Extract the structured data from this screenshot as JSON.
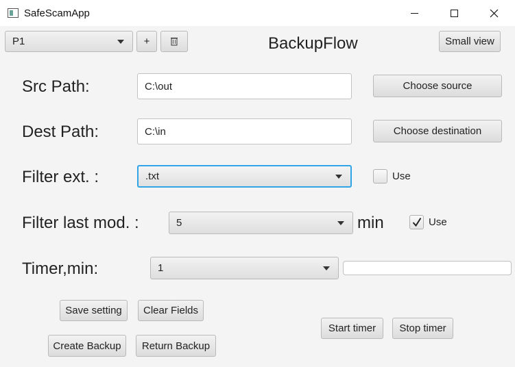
{
  "window": {
    "title": "SafeScamApp"
  },
  "toolbar": {
    "profile_select": "P1",
    "add_label": "+",
    "delete_icon": "trash-icon",
    "app_heading": "BackupFlow",
    "small_view_label": "Small view"
  },
  "source": {
    "label": "Src Path:",
    "value": "C:\\out",
    "button_label": "Choose source"
  },
  "destination": {
    "label": "Dest Path:",
    "value": "C:\\in",
    "button_label": "Choose destination"
  },
  "filter_ext": {
    "label": "Filter ext. :",
    "selected": ".txt",
    "use_label": "Use",
    "use_checked": false
  },
  "filter_mod": {
    "label": "Filter last mod. :",
    "selected": "5",
    "unit": "min",
    "use_label": "Use",
    "use_checked": true
  },
  "timer": {
    "label": "Timer,min:",
    "selected": "1",
    "progress": 0
  },
  "actions": {
    "save_setting": "Save setting",
    "clear_fields": "Clear Fields",
    "create_backup": "Create Backup",
    "return_backup": "Return Backup",
    "start_timer": "Start timer",
    "stop_timer": "Stop timer"
  },
  "colors": {
    "focus": "#2fa5e8",
    "background": "#f4f4f4"
  }
}
